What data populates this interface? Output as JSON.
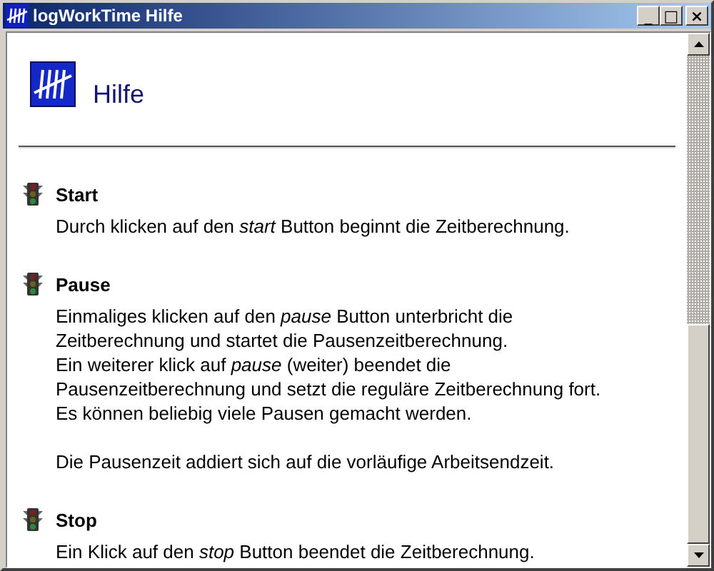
{
  "window": {
    "title": "logWorkTime Hilfe",
    "controls": [
      "_",
      "□",
      "×"
    ]
  },
  "header": {
    "title": "Hilfe"
  },
  "sections": [
    {
      "heading": "Start",
      "paragraphs": [
        [
          "Durch klicken auf den *start* Button beginnt die Zeitberechnung."
        ]
      ]
    },
    {
      "heading": "Pause",
      "paragraphs": [
        [
          "Einmaliges klicken auf den *pause* Button unterbricht die",
          "Zeitberechnung und startet die Pausenzeitberechnung.",
          "Ein weiterer klick auf *pause* (weiter) beendet die",
          "Pausenzeitberechnung und setzt die reguläre Zeitberechnung fort.",
          "Es können beliebig viele Pausen gemacht werden."
        ],
        [
          "Die Pausenzeit addiert sich auf die vorläufige Arbeitsendzeit."
        ]
      ]
    },
    {
      "heading": "Stop",
      "paragraphs": [
        [
          "Ein Klick auf den *stop* Button beendet die Zeitberechnung."
        ]
      ]
    }
  ]
}
